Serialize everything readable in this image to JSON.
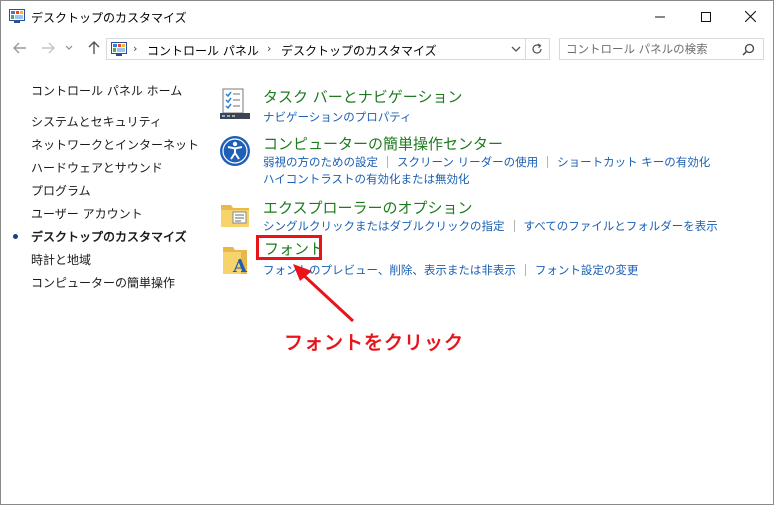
{
  "window": {
    "title": "デスクトップのカスタマイズ"
  },
  "address": {
    "segments": [
      "コントロール パネル",
      "デスクトップのカスタマイズ"
    ]
  },
  "search": {
    "placeholder": "コントロール パネルの検索"
  },
  "sidebar": {
    "home": "コントロール パネル ホーム",
    "items": [
      {
        "label": "システムとセキュリティ",
        "current": false
      },
      {
        "label": "ネットワークとインターネット",
        "current": false
      },
      {
        "label": "ハードウェアとサウンド",
        "current": false
      },
      {
        "label": "プログラム",
        "current": false
      },
      {
        "label": "ユーザー アカウント",
        "current": false
      },
      {
        "label": "デスクトップのカスタマイズ",
        "current": true
      },
      {
        "label": "時計と地域",
        "current": false
      },
      {
        "label": "コンピューターの簡単操作",
        "current": false
      }
    ]
  },
  "sections": [
    {
      "title": "タスク バーとナビゲーション",
      "icon": "taskbar-icon",
      "links": [
        [
          "ナビゲーションのプロパティ"
        ]
      ]
    },
    {
      "title": "コンピューターの簡単操作センター",
      "icon": "ease-of-access-icon",
      "links": [
        [
          "弱視の方のための設定",
          "スクリーン リーダーの使用",
          "ショートカット キーの有効化"
        ],
        [
          "ハイコントラストの有効化または無効化"
        ]
      ]
    },
    {
      "title": "エクスプローラーのオプション",
      "icon": "folder-options-icon",
      "links": [
        [
          "シングルクリックまたはダブルクリックの指定",
          "すべてのファイルとフォルダーを表示"
        ]
      ]
    },
    {
      "title": "フォント",
      "icon": "fonts-folder-icon",
      "links": [
        [
          "フォントのプレビュー、削除、表示または非表示",
          "フォント設定の変更"
        ]
      ]
    }
  ],
  "annotation": {
    "text": "フォントをクリック",
    "color": "#e8141a"
  },
  "colors": {
    "section_title": "#1e7b1e",
    "link": "#1a5fb4",
    "highlight": "#e8141a"
  }
}
